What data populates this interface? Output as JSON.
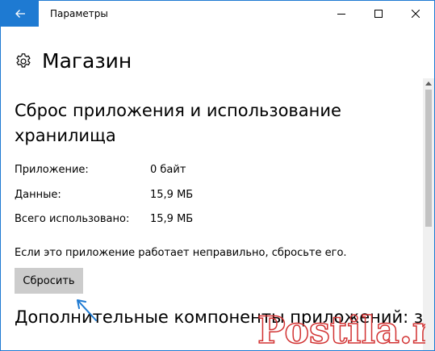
{
  "window": {
    "title": "Параметры",
    "accent_color": "#1e7ad2"
  },
  "header": {
    "icon": "gear-icon",
    "title": "Магазин"
  },
  "reset_section": {
    "title": "Сброс приложения и использование хранилища",
    "rows": [
      {
        "label": "Приложение:",
        "value": "0 байт"
      },
      {
        "label": "Данные:",
        "value": "15,9 МБ"
      },
      {
        "label": "Всего использовано:",
        "value": "15,9 МБ"
      }
    ],
    "hint": "Если это приложение работает неправильно, сбросьте его.",
    "reset_label": "Сбросить"
  },
  "next_section": {
    "title": "Дополнительные компоненты приложений: загружаемое содержимое"
  },
  "watermark": {
    "text": "Postila.ru",
    "color": "#d23232"
  }
}
